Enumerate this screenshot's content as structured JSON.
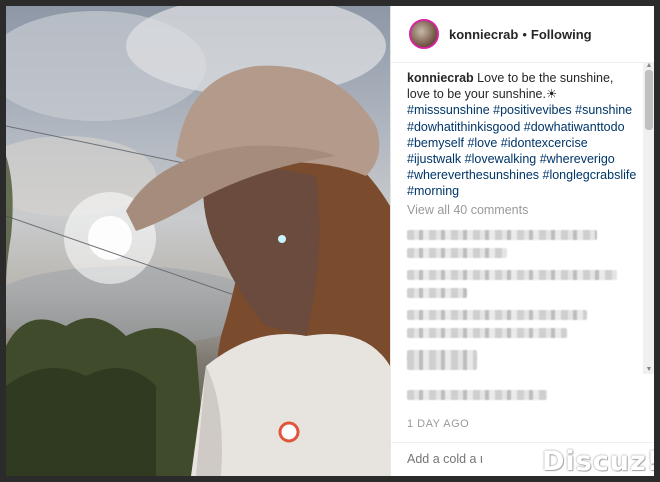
{
  "post": {
    "username": "konniecrab",
    "separator": "•",
    "follow_status": "Following",
    "caption_user": "konniecrab",
    "caption_text": "Love to be the sunshine, love to be your sunshine.☀",
    "hashtags": "#misssunshine #positivevibes #sunshine #dowhatithinkisgood #dowhatiwanttodo #bemyself #love #idontexcercise #ijustwalk #lovewalking #whereverigo #whereverthesunshines #longlegcrabslife #morning",
    "view_all": "View all 40 comments",
    "time": "1 DAY AGO",
    "comment_placeholder": "Add a cold a ι"
  },
  "watermark": "Discuz!",
  "icons": {
    "scroll_up": "triangle-up",
    "scroll_down": "triangle-down"
  }
}
